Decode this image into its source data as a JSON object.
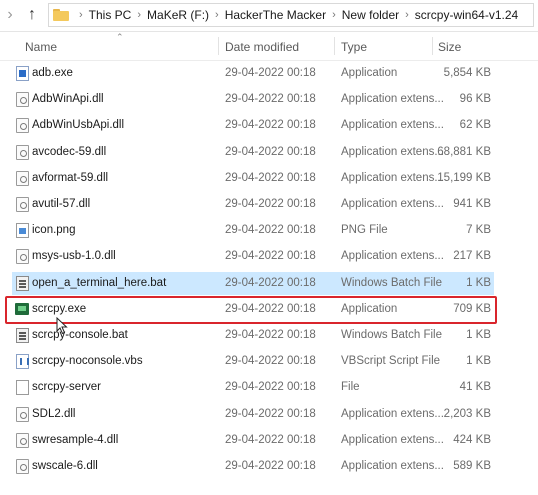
{
  "address": {
    "crumbs": [
      "This PC",
      "MaKeR (F:)",
      "HackerThe Macker",
      "New folder",
      "scrcpy-win64-v1.24"
    ]
  },
  "columns": {
    "name": "Name",
    "date": "Date modified",
    "type": "Type",
    "size": "Size"
  },
  "files": [
    {
      "name": "adb.exe",
      "date": "29-04-2022 00:18",
      "type": "Application",
      "size": "5,854 KB",
      "icon": "exe-icon"
    },
    {
      "name": "AdbWinApi.dll",
      "date": "29-04-2022 00:18",
      "type": "Application extens...",
      "size": "96 KB",
      "icon": "dll-icon"
    },
    {
      "name": "AdbWinUsbApi.dll",
      "date": "29-04-2022 00:18",
      "type": "Application extens...",
      "size": "62 KB",
      "icon": "dll-icon"
    },
    {
      "name": "avcodec-59.dll",
      "date": "29-04-2022 00:18",
      "type": "Application extens...",
      "size": "68,881 KB",
      "icon": "dll-icon"
    },
    {
      "name": "avformat-59.dll",
      "date": "29-04-2022 00:18",
      "type": "Application extens...",
      "size": "15,199 KB",
      "icon": "dll-icon"
    },
    {
      "name": "avutil-57.dll",
      "date": "29-04-2022 00:18",
      "type": "Application extens...",
      "size": "941 KB",
      "icon": "dll-icon"
    },
    {
      "name": "icon.png",
      "date": "29-04-2022 00:18",
      "type": "PNG File",
      "size": "7 KB",
      "icon": "png-icon"
    },
    {
      "name": "msys-usb-1.0.dll",
      "date": "29-04-2022 00:18",
      "type": "Application extens...",
      "size": "217 KB",
      "icon": "dll-icon"
    },
    {
      "name": "open_a_terminal_here.bat",
      "date": "29-04-2022 00:18",
      "type": "Windows Batch File",
      "size": "1 KB",
      "icon": "bat-icon",
      "selected": true
    },
    {
      "name": "scrcpy.exe",
      "date": "29-04-2022 00:18",
      "type": "Application",
      "size": "709 KB",
      "icon": "scrcpy-app-icon",
      "highlighted": true
    },
    {
      "name": "scrcpy-console.bat",
      "date": "29-04-2022 00:18",
      "type": "Windows Batch File",
      "size": "1 KB",
      "icon": "bat-icon"
    },
    {
      "name": "scrcpy-noconsole.vbs",
      "date": "29-04-2022 00:18",
      "type": "VBScript Script File",
      "size": "1 KB",
      "icon": "vbs-icon"
    },
    {
      "name": "scrcpy-server",
      "date": "29-04-2022 00:18",
      "type": "File",
      "size": "41 KB",
      "icon": "file-icon"
    },
    {
      "name": "SDL2.dll",
      "date": "29-04-2022 00:18",
      "type": "Application extens...",
      "size": "2,203 KB",
      "icon": "dll-icon"
    },
    {
      "name": "swresample-4.dll",
      "date": "29-04-2022 00:18",
      "type": "Application extens...",
      "size": "424 KB",
      "icon": "dll-icon"
    },
    {
      "name": "swscale-6.dll",
      "date": "29-04-2022 00:18",
      "type": "Application extens...",
      "size": "589 KB",
      "icon": "dll-icon"
    }
  ],
  "colors": {
    "selection": "#cce8ff",
    "highlight_border": "#d9252c"
  }
}
